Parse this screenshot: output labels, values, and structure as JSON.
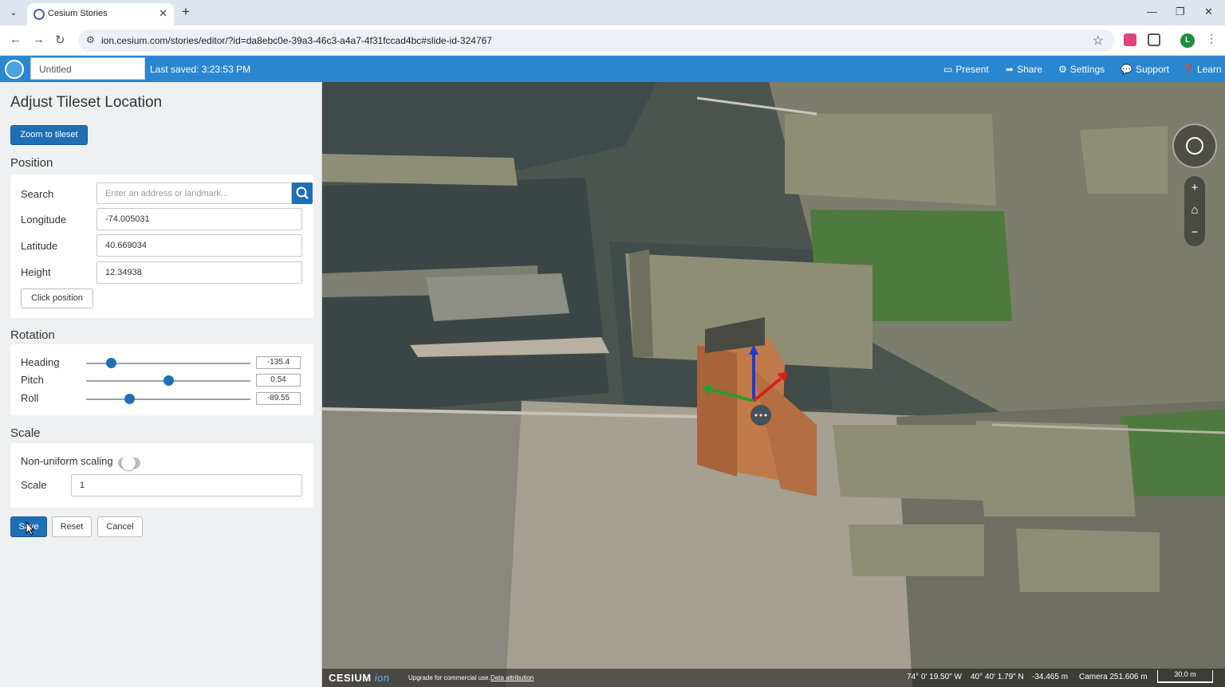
{
  "browser": {
    "tab_title": "Cesium Stories",
    "url": "ion.cesium.com/stories/editor/?id=da8ebc0e-39a3-46c3-a4a7-4f31fccad4bc#slide-id-324767",
    "profile_initial": "L"
  },
  "app": {
    "story_title_placeholder": "Untitled",
    "last_saved": "Last saved: 3:23:53 PM",
    "nav": {
      "present": "Present",
      "share": "Share",
      "settings": "Settings",
      "support": "Support",
      "learn": "Learn"
    }
  },
  "panel": {
    "title": "Adjust Tileset Location",
    "zoom_button": "Zoom to tileset",
    "position": {
      "heading": "Position",
      "search_label": "Search",
      "search_placeholder": "Enter an address or landmark...",
      "longitude_label": "Longitude",
      "longitude": "-74.005031",
      "latitude_label": "Latitude",
      "latitude": "40.669034",
      "height_label": "Height",
      "height": "12.34938",
      "click_position": "Click position"
    },
    "rotation": {
      "heading": "Rotation",
      "heading_label": "Heading",
      "heading_value": "-135.4",
      "heading_fraction": 0.15,
      "pitch_label": "Pitch",
      "pitch_value": "0.54",
      "pitch_fraction": 0.5,
      "roll_label": "Roll",
      "roll_value": "-89.55",
      "roll_fraction": 0.26
    },
    "scale": {
      "heading": "Scale",
      "nonuniform_label": "Non-uniform scaling",
      "nonuniform_on": false,
      "scale_label": "Scale",
      "scale_value": "1"
    },
    "buttons": {
      "save": "Save",
      "reset": "Reset",
      "cancel": "Cancel"
    }
  },
  "viewer": {
    "credit_logo": "CESIUM",
    "credit_ion": "ion",
    "upgrade_text": "Upgrade for commercial use.",
    "attribution_link": "Data attribution",
    "lon": "74° 0' 19.50\" W",
    "lat": "40° 40' 1.79\" N",
    "elevation": "-34.465 m",
    "camera": "Camera 251.606 m",
    "scale_bar": "30.0 m"
  },
  "colors": {
    "accent": "#2a86cf",
    "button": "#1f6fb6"
  }
}
